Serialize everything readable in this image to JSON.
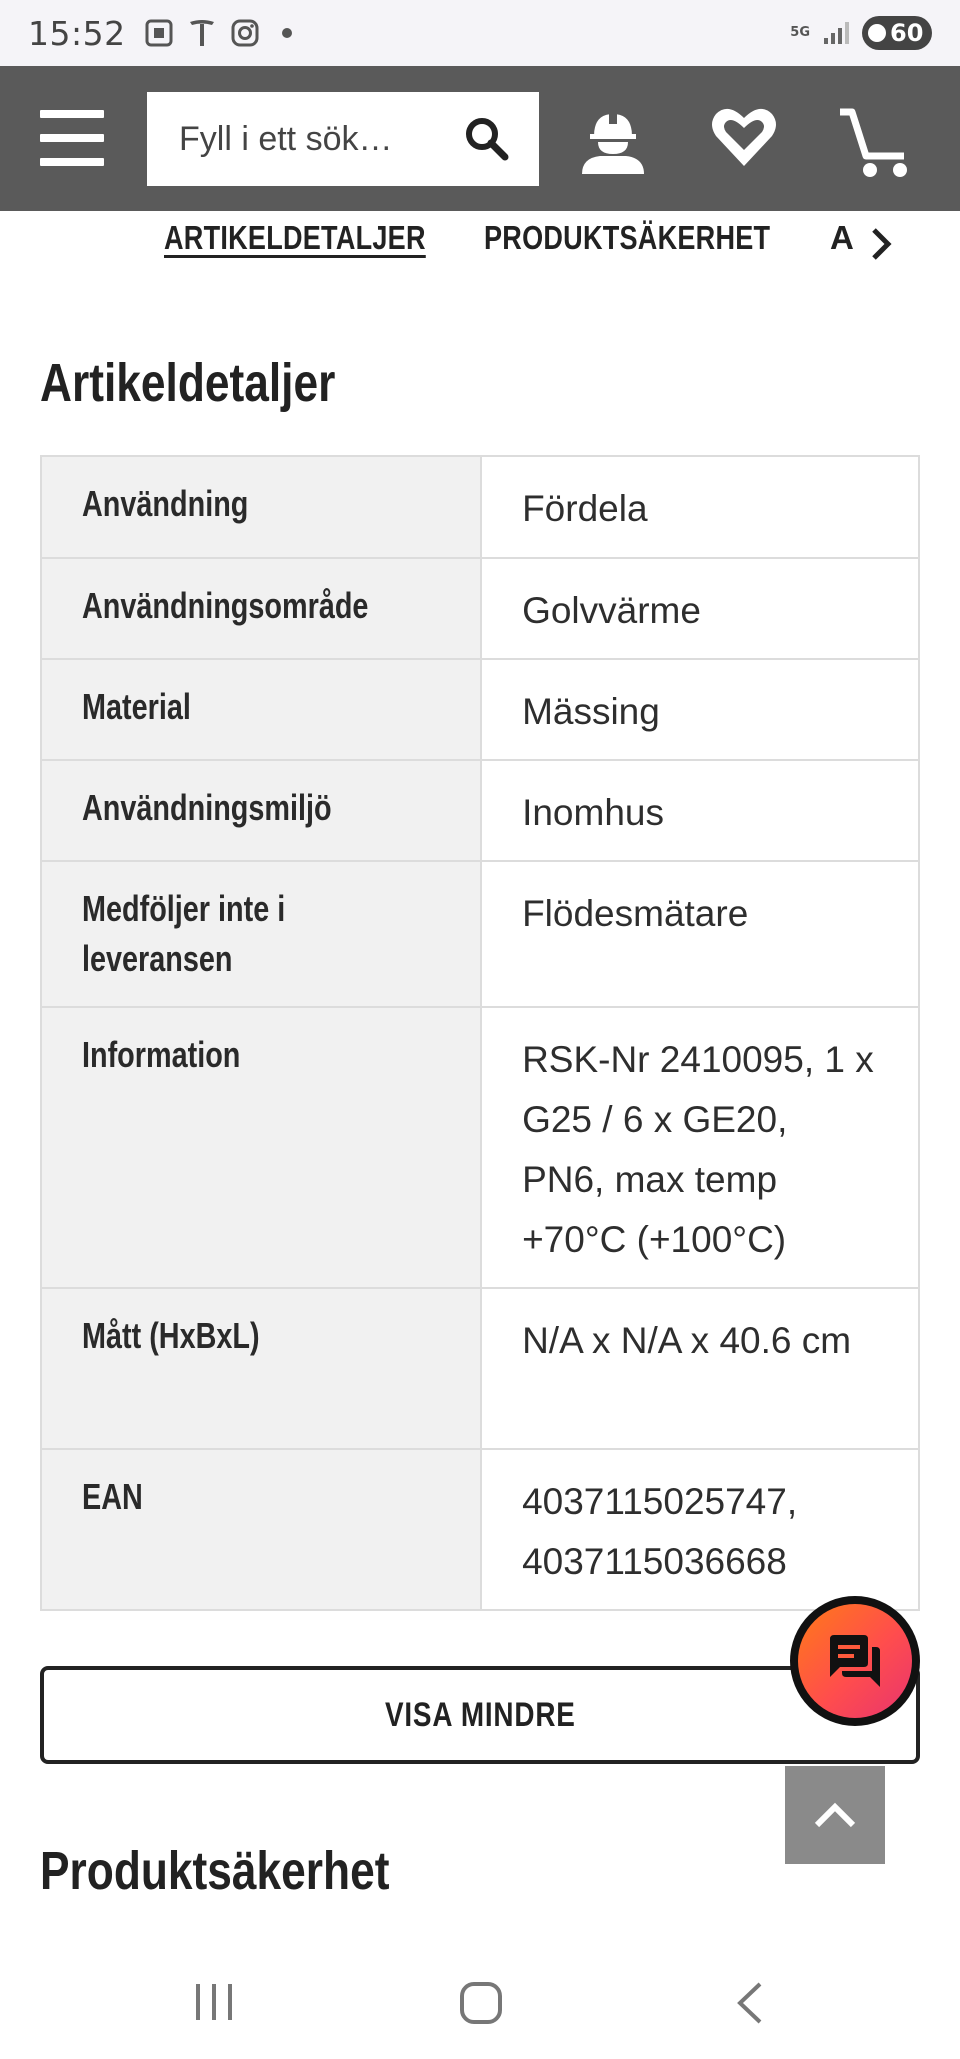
{
  "status_bar": {
    "time": "15:52",
    "network": "5G",
    "battery": "60"
  },
  "header": {
    "search_placeholder": "Fyll i ett sök…"
  },
  "tabs": [
    {
      "label": "ARTIKELDETALJER",
      "active": true
    },
    {
      "label": "PRODUKTSÄKERHET",
      "active": false
    },
    {
      "label": "A",
      "active": false
    }
  ],
  "section_artikel": {
    "title": "Artikeldetaljer"
  },
  "details": [
    {
      "key": "Användning",
      "value": "Fördela"
    },
    {
      "key": "Användningsområde",
      "value": "Golvvärme"
    },
    {
      "key": "Material",
      "value": "Mässing"
    },
    {
      "key": "Användningsmiljö",
      "value": "Inomhus"
    },
    {
      "key": "Medföljer inte i leveransen",
      "value": "Flödesmätare"
    },
    {
      "key": "Information",
      "value": "RSK-Nr 2410095, 1 x G25 / 6 x GE20, PN6, max temp +70°C (+100°C)"
    },
    {
      "key": "Mått (HxBxL)",
      "value": "N/A x N/A x 40.6 cm"
    },
    {
      "key": "EAN",
      "value": "4037115025747, 4037115036668"
    }
  ],
  "visa_mindre": "VISA MINDRE",
  "section_produkt": {
    "title": "Produktsäkerhet"
  },
  "colors": {
    "header_bg": "#5a5a5a",
    "key_cell_bg": "#f1f1f1",
    "chat_gradient_start": "#ff7a18",
    "chat_gradient_end": "#e8346f"
  }
}
